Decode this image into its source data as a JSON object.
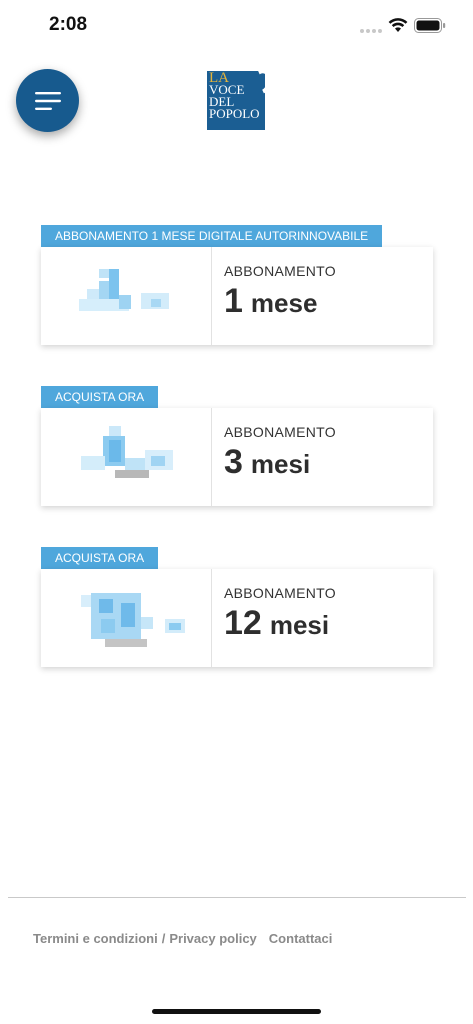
{
  "status_bar": {
    "time": "2:08",
    "icons": [
      "cellular-dots-icon",
      "wifi-icon",
      "battery-icon"
    ]
  },
  "header": {
    "menu_icon": "hamburger-icon",
    "logo": {
      "line1": "LA",
      "line2": "VOCE",
      "line3": "DEL",
      "line4": "POPOLO"
    }
  },
  "plans": [
    {
      "tag": "ABBONAMENTO 1 MESE DIGITALE AUTORINNOVABILE",
      "label": "ABBONAMENTO",
      "number": "1",
      "unit": "mese"
    },
    {
      "tag": "ACQUISTA ORA",
      "label": "ABBONAMENTO",
      "number": "3",
      "unit": "mesi"
    },
    {
      "tag": "ACQUISTA ORA",
      "label": "ABBONAMENTO",
      "number": "12",
      "unit": "mesi"
    }
  ],
  "footer": {
    "terms": "Termini e condizioni",
    "separator": "/",
    "privacy": "Privacy policy",
    "contact": "Contattaci"
  },
  "colors": {
    "accent": "#4fa7dc",
    "brand": "#175a8e",
    "footer_text": "#8a8a8a"
  }
}
